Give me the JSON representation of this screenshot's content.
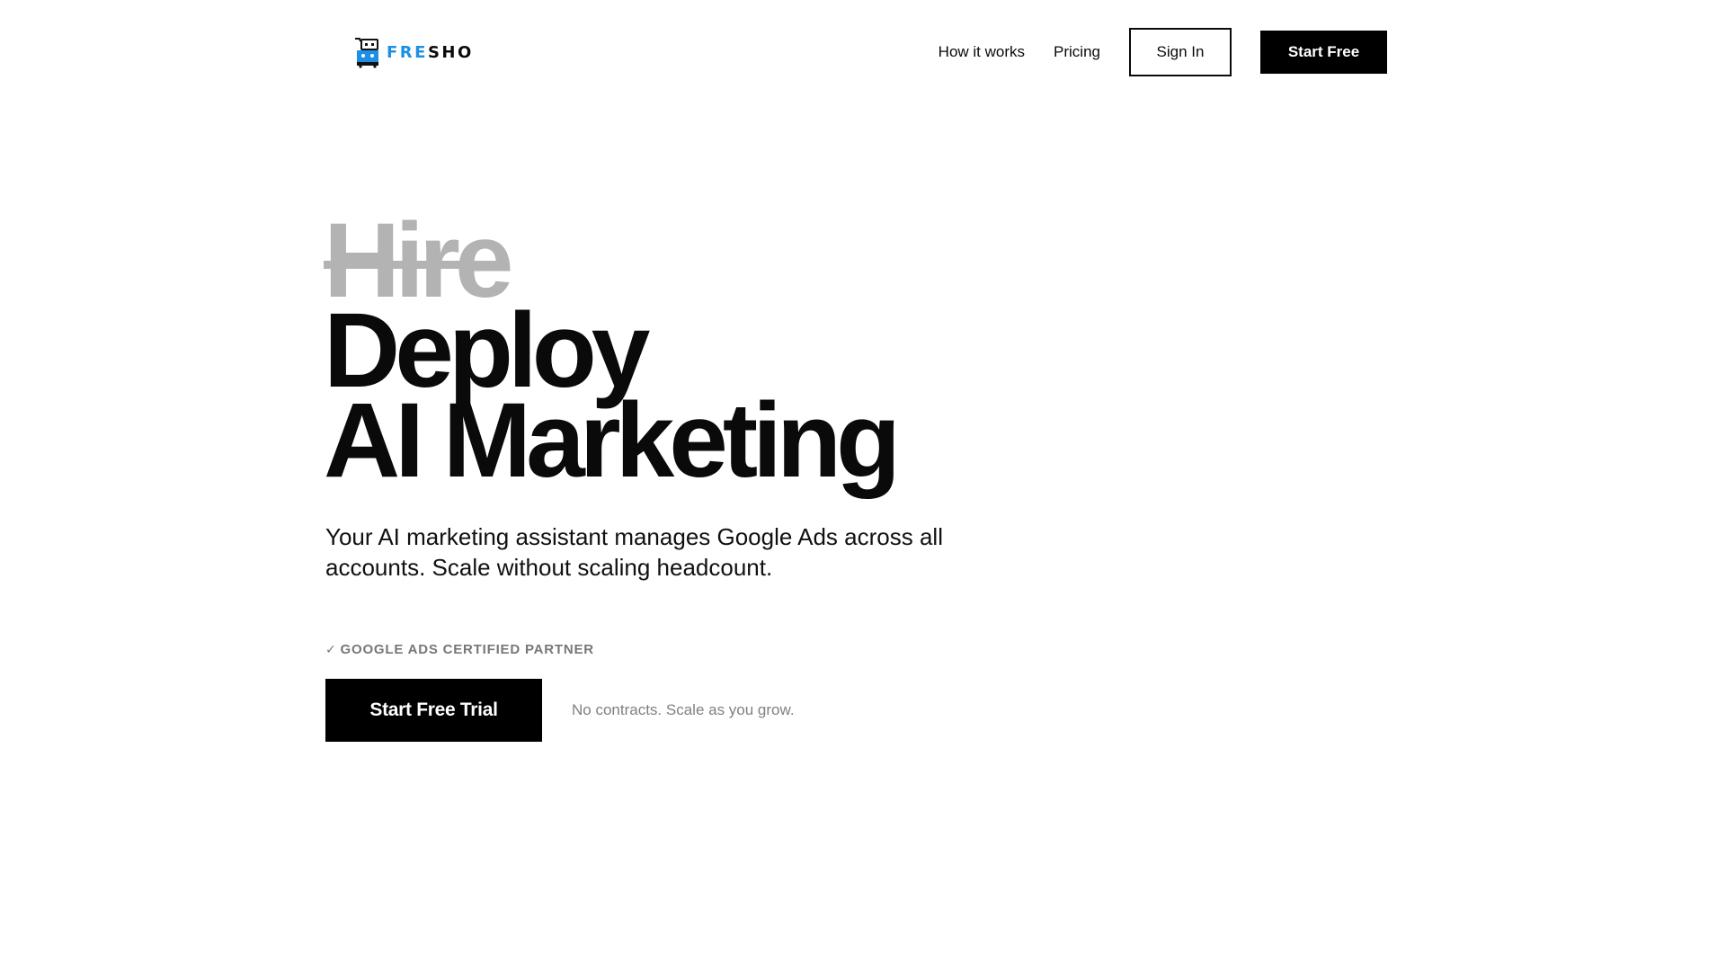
{
  "header": {
    "logo": {
      "icon": "shopping-cart-robot-icon",
      "text_part_a": "FRE",
      "text_part_b": "SHO"
    },
    "nav": {
      "how_it_works": "How it works",
      "pricing": "Pricing",
      "sign_in": "Sign In",
      "start_free": "Start Free"
    }
  },
  "hero": {
    "headline_struck": "Hire",
    "headline_line_1": "Deploy",
    "headline_line_2": "AI Marketing",
    "subtitle": "Your AI marketing assistant manages Google Ads across all accounts. Scale without scaling headcount.",
    "badge_check": "✓",
    "badge_text": "GOOGLE ADS CERTIFIED PARTNER",
    "cta_button": "Start Free Trial",
    "cta_note": "No contracts. Scale as you grow."
  },
  "colors": {
    "brand_blue": "#1e8fe6",
    "text_black": "#0a0a0a",
    "struck_gray": "#b3b3b3",
    "muted_gray": "#777777",
    "button_black": "#000000"
  }
}
